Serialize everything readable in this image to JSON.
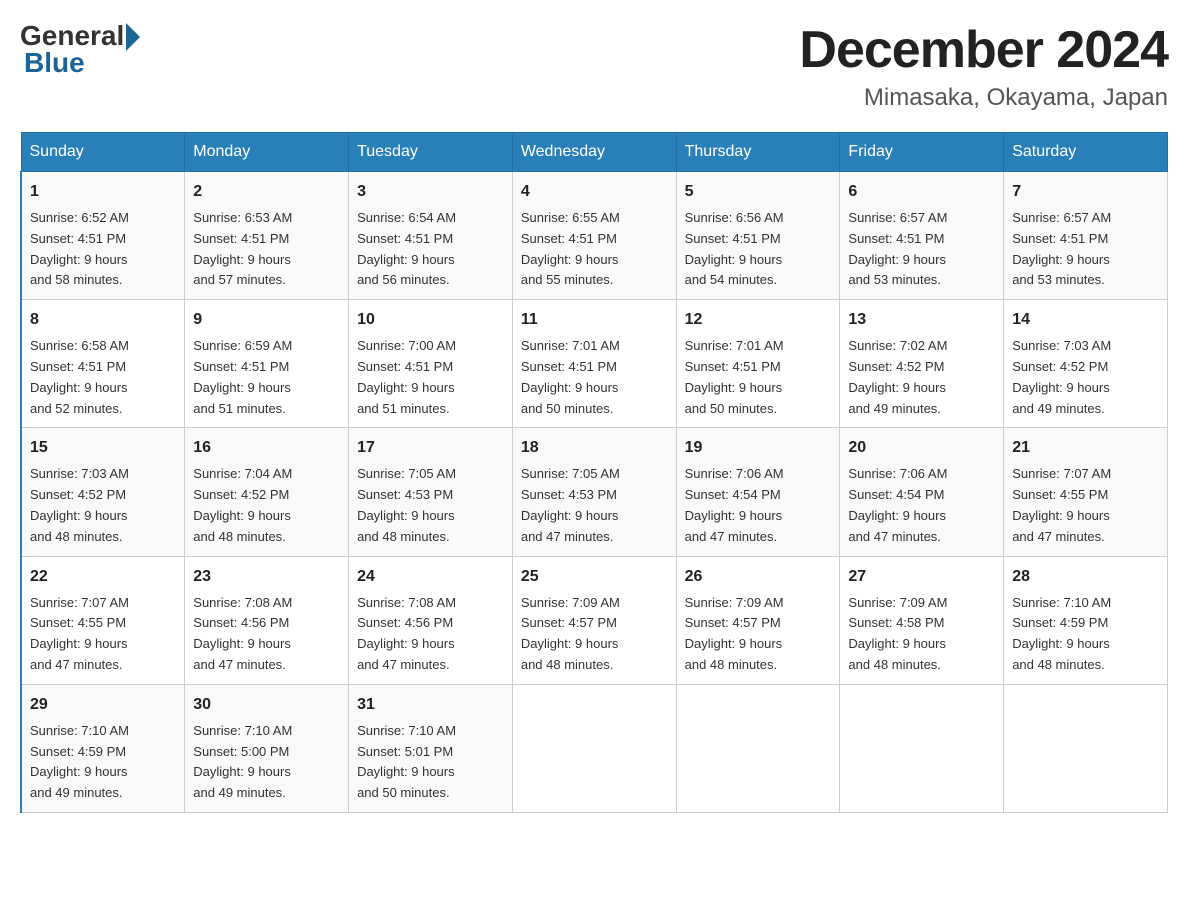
{
  "logo": {
    "general": "General",
    "blue": "Blue"
  },
  "title": "December 2024",
  "location": "Mimasaka, Okayama, Japan",
  "days_of_week": [
    "Sunday",
    "Monday",
    "Tuesday",
    "Wednesday",
    "Thursday",
    "Friday",
    "Saturday"
  ],
  "weeks": [
    [
      {
        "day": "1",
        "sunrise": "6:52 AM",
        "sunset": "4:51 PM",
        "daylight": "9 hours and 58 minutes."
      },
      {
        "day": "2",
        "sunrise": "6:53 AM",
        "sunset": "4:51 PM",
        "daylight": "9 hours and 57 minutes."
      },
      {
        "day": "3",
        "sunrise": "6:54 AM",
        "sunset": "4:51 PM",
        "daylight": "9 hours and 56 minutes."
      },
      {
        "day": "4",
        "sunrise": "6:55 AM",
        "sunset": "4:51 PM",
        "daylight": "9 hours and 55 minutes."
      },
      {
        "day": "5",
        "sunrise": "6:56 AM",
        "sunset": "4:51 PM",
        "daylight": "9 hours and 54 minutes."
      },
      {
        "day": "6",
        "sunrise": "6:57 AM",
        "sunset": "4:51 PM",
        "daylight": "9 hours and 53 minutes."
      },
      {
        "day": "7",
        "sunrise": "6:57 AM",
        "sunset": "4:51 PM",
        "daylight": "9 hours and 53 minutes."
      }
    ],
    [
      {
        "day": "8",
        "sunrise": "6:58 AM",
        "sunset": "4:51 PM",
        "daylight": "9 hours and 52 minutes."
      },
      {
        "day": "9",
        "sunrise": "6:59 AM",
        "sunset": "4:51 PM",
        "daylight": "9 hours and 51 minutes."
      },
      {
        "day": "10",
        "sunrise": "7:00 AM",
        "sunset": "4:51 PM",
        "daylight": "9 hours and 51 minutes."
      },
      {
        "day": "11",
        "sunrise": "7:01 AM",
        "sunset": "4:51 PM",
        "daylight": "9 hours and 50 minutes."
      },
      {
        "day": "12",
        "sunrise": "7:01 AM",
        "sunset": "4:51 PM",
        "daylight": "9 hours and 50 minutes."
      },
      {
        "day": "13",
        "sunrise": "7:02 AM",
        "sunset": "4:52 PM",
        "daylight": "9 hours and 49 minutes."
      },
      {
        "day": "14",
        "sunrise": "7:03 AM",
        "sunset": "4:52 PM",
        "daylight": "9 hours and 49 minutes."
      }
    ],
    [
      {
        "day": "15",
        "sunrise": "7:03 AM",
        "sunset": "4:52 PM",
        "daylight": "9 hours and 48 minutes."
      },
      {
        "day": "16",
        "sunrise": "7:04 AM",
        "sunset": "4:52 PM",
        "daylight": "9 hours and 48 minutes."
      },
      {
        "day": "17",
        "sunrise": "7:05 AM",
        "sunset": "4:53 PM",
        "daylight": "9 hours and 48 minutes."
      },
      {
        "day": "18",
        "sunrise": "7:05 AM",
        "sunset": "4:53 PM",
        "daylight": "9 hours and 47 minutes."
      },
      {
        "day": "19",
        "sunrise": "7:06 AM",
        "sunset": "4:54 PM",
        "daylight": "9 hours and 47 minutes."
      },
      {
        "day": "20",
        "sunrise": "7:06 AM",
        "sunset": "4:54 PM",
        "daylight": "9 hours and 47 minutes."
      },
      {
        "day": "21",
        "sunrise": "7:07 AM",
        "sunset": "4:55 PM",
        "daylight": "9 hours and 47 minutes."
      }
    ],
    [
      {
        "day": "22",
        "sunrise": "7:07 AM",
        "sunset": "4:55 PM",
        "daylight": "9 hours and 47 minutes."
      },
      {
        "day": "23",
        "sunrise": "7:08 AM",
        "sunset": "4:56 PM",
        "daylight": "9 hours and 47 minutes."
      },
      {
        "day": "24",
        "sunrise": "7:08 AM",
        "sunset": "4:56 PM",
        "daylight": "9 hours and 47 minutes."
      },
      {
        "day": "25",
        "sunrise": "7:09 AM",
        "sunset": "4:57 PM",
        "daylight": "9 hours and 48 minutes."
      },
      {
        "day": "26",
        "sunrise": "7:09 AM",
        "sunset": "4:57 PM",
        "daylight": "9 hours and 48 minutes."
      },
      {
        "day": "27",
        "sunrise": "7:09 AM",
        "sunset": "4:58 PM",
        "daylight": "9 hours and 48 minutes."
      },
      {
        "day": "28",
        "sunrise": "7:10 AM",
        "sunset": "4:59 PM",
        "daylight": "9 hours and 48 minutes."
      }
    ],
    [
      {
        "day": "29",
        "sunrise": "7:10 AM",
        "sunset": "4:59 PM",
        "daylight": "9 hours and 49 minutes."
      },
      {
        "day": "30",
        "sunrise": "7:10 AM",
        "sunset": "5:00 PM",
        "daylight": "9 hours and 49 minutes."
      },
      {
        "day": "31",
        "sunrise": "7:10 AM",
        "sunset": "5:01 PM",
        "daylight": "9 hours and 50 minutes."
      },
      null,
      null,
      null,
      null
    ]
  ],
  "labels": {
    "sunrise": "Sunrise:",
    "sunset": "Sunset:",
    "daylight": "Daylight:"
  }
}
